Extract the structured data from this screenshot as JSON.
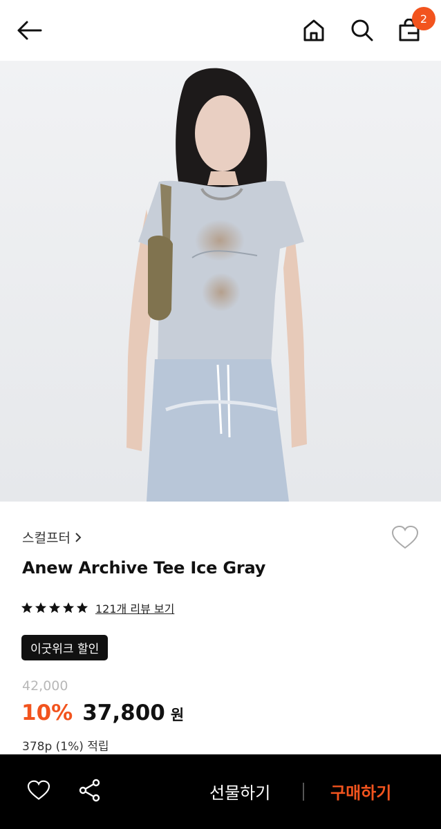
{
  "header": {
    "cart_count": "2"
  },
  "product": {
    "brand": "스컬프터",
    "title": "Anew Archive Tee Ice Gray",
    "rating_stars": 5,
    "review_link": "121개 리뷰 보기",
    "promo_badge": "이굿위크 할인",
    "original_price": "42,000",
    "discount_rate": "10%",
    "sale_price": "37,800",
    "currency": "원",
    "points": "378p (1%) 적립"
  },
  "bottom_bar": {
    "gift_label": "선물하기",
    "buy_label": "구매하기"
  },
  "colors": {
    "accent": "#f2541e",
    "bar_bg": "#000000"
  }
}
